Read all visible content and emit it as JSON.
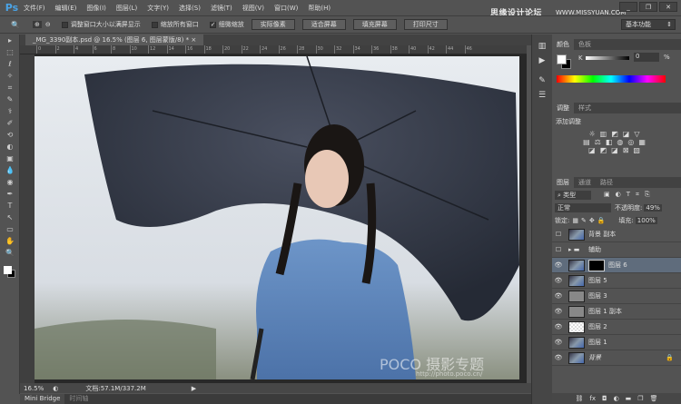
{
  "app": {
    "logo": "Ps",
    "watermark": "思缘设计论坛",
    "watermark_url": "WWW.MISSYUAN.COM",
    "win": [
      "_",
      "❐",
      "✕"
    ]
  },
  "menu": [
    "文件(F)",
    "编辑(E)",
    "图像(I)",
    "图层(L)",
    "文字(Y)",
    "选择(S)",
    "滤镜(T)",
    "视图(V)",
    "窗口(W)",
    "帮助(H)"
  ],
  "options": {
    "zoom_icon": "🔍",
    "checks": [
      {
        "label": "调整窗口大小以满屏显示",
        "checked": false
      },
      {
        "label": "缩放所有窗口",
        "checked": false
      },
      {
        "label": "细微缩放",
        "checked": true
      }
    ],
    "buttons": [
      "实际像素",
      "适合屏幕",
      "填充屏幕",
      "打印尺寸"
    ],
    "workspace": "基本功能"
  },
  "document": {
    "tab": "_MG_3390副本.psd @ 16.5% (图层 6, 图层蒙版/8) *",
    "close": "×",
    "ruler": [
      "0",
      "2",
      "4",
      "6",
      "8",
      "10",
      "12",
      "14",
      "16",
      "18",
      "20",
      "22",
      "24",
      "26",
      "28",
      "30",
      "32",
      "34",
      "36",
      "38",
      "40",
      "42",
      "44",
      "46"
    ],
    "photo_watermark": "POCO 摄影专题",
    "photo_url": "http://photo.poco.cn/"
  },
  "status": {
    "zoom": "16.5%",
    "doc": "文档:57.1M/337.2M"
  },
  "bottom_tabs": [
    "Mini Bridge",
    "时间轴"
  ],
  "tools": [
    "▸",
    "⬚",
    "ℓ",
    "✧",
    "⌗",
    "✎",
    "⚕",
    "✐",
    "⟲",
    "◐",
    "▣",
    "💧",
    "◉",
    "✒",
    "T",
    "↖",
    "▭",
    "✋",
    "🔍"
  ],
  "color_panel": {
    "tabs": [
      "颜色",
      "色板"
    ],
    "channel": "K",
    "value": "0",
    "unit": "%"
  },
  "adjust_panel": {
    "tabs": [
      "调整",
      "样式"
    ],
    "title": "添加调整"
  },
  "layers_panel": {
    "tabs": [
      "图层",
      "通道",
      "路径"
    ],
    "filter": "类型",
    "blend": "正常",
    "opacity_label": "不透明度:",
    "opacity": "49%",
    "lock_label": "锁定:",
    "fill_label": "填充:",
    "fill": "100%",
    "layers": [
      {
        "name": "背景 副本",
        "visible": false,
        "thumb": "photo"
      },
      {
        "name": "辅助",
        "visible": false,
        "thumb": "folder"
      },
      {
        "name": "图层 6",
        "visible": true,
        "thumb": "photo",
        "mask": true,
        "selected": true
      },
      {
        "name": "图层 5",
        "visible": true,
        "thumb": "photo"
      },
      {
        "name": "图层 3",
        "visible": true,
        "thumb": "gray"
      },
      {
        "name": "图层 1 副本",
        "visible": true,
        "thumb": "gray"
      },
      {
        "name": "图层 2",
        "visible": true,
        "thumb": "checker"
      },
      {
        "name": "图层 1",
        "visible": true,
        "thumb": "photo"
      },
      {
        "name": "背景",
        "visible": true,
        "thumb": "photo",
        "locked": true
      }
    ],
    "footer_icons": [
      "⛓",
      "fx",
      "◘",
      "◐",
      "▬",
      "❐",
      "🗑"
    ]
  }
}
